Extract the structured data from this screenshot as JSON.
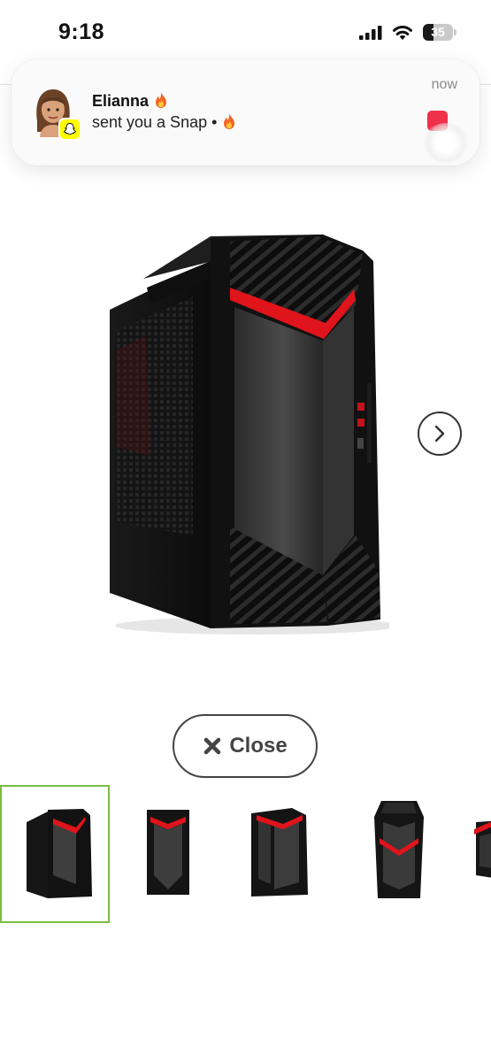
{
  "status_bar": {
    "time": "9:18",
    "battery_label": "35",
    "battery_level": 0.35
  },
  "notification": {
    "app_icon": "snapchat-ghost-icon",
    "sender": "Elianna",
    "message": "sent you a Snap •",
    "time": "now",
    "emoji": "fire-emoji"
  },
  "product": {
    "image": "gaming-desktop-tower-image",
    "next_icon": "chevron-right-icon"
  },
  "actions": {
    "close_label": "Close",
    "close_icon": "x-icon"
  },
  "thumbnails": {
    "selected_index": 0,
    "items": [
      {
        "image": "tower-front-angle-thumb"
      },
      {
        "image": "tower-front-thumb"
      },
      {
        "image": "tower-side-angle-thumb"
      },
      {
        "image": "tower-top-angle-thumb"
      },
      {
        "image": "tower-partial-thumb"
      }
    ]
  },
  "colors": {
    "accent_red": "#e0141b",
    "selected_border": "#7bbd42",
    "snap_yellow": "#fffc00"
  }
}
